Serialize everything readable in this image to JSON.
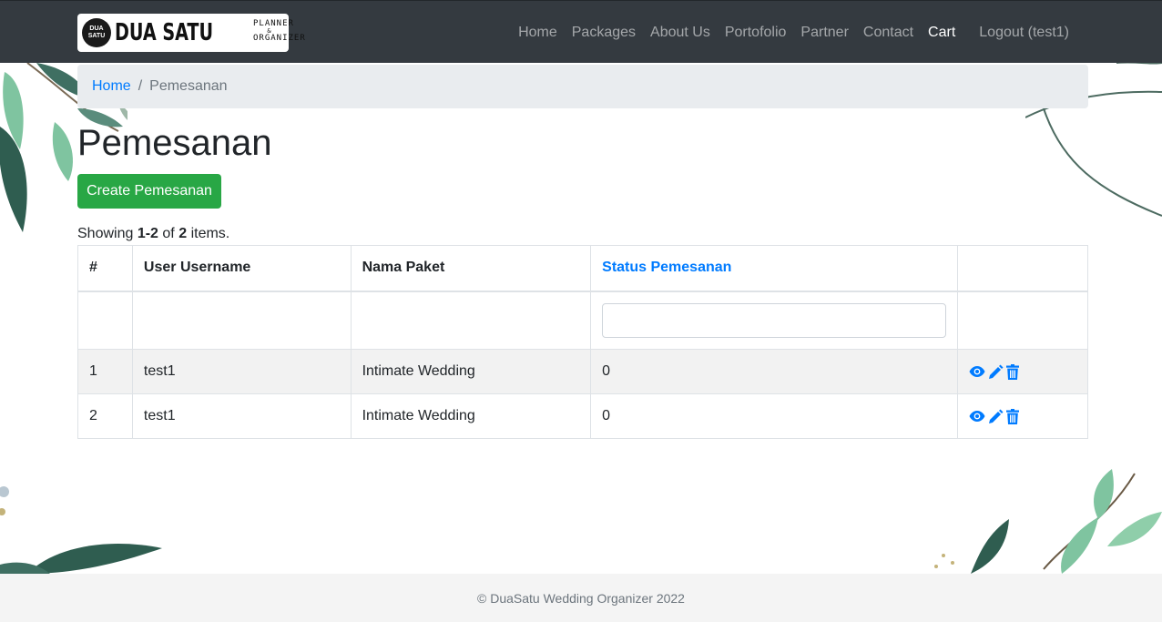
{
  "brand": {
    "badge_line1": "DUA",
    "badge_line2": "SATU",
    "name": "DUA SATU",
    "tagline1": "PLANNER",
    "tagline2": "&",
    "tagline3": "ORGANIZER"
  },
  "nav": {
    "items": [
      {
        "label": "Home"
      },
      {
        "label": "Packages"
      },
      {
        "label": "About Us"
      },
      {
        "label": "Portofolio"
      },
      {
        "label": "Partner"
      },
      {
        "label": "Contact"
      },
      {
        "label": "Cart"
      }
    ],
    "logout_label": "Logout (test1)"
  },
  "breadcrumb": {
    "home": "Home",
    "separator": "/",
    "current": "Pemesanan"
  },
  "page": {
    "title": "Pemesanan",
    "create_button": "Create Pemesanan",
    "summary_prefix": "Showing",
    "summary_range": "1-2",
    "summary_of": "of",
    "summary_total": "2",
    "summary_suffix": "items."
  },
  "table": {
    "columns": [
      "#",
      "User Username",
      "Nama Paket",
      "Status Pemesanan",
      ""
    ],
    "filter_value": "",
    "rows": [
      {
        "no": "1",
        "user": "test1",
        "paket": "Intimate Wedding",
        "status": "0"
      },
      {
        "no": "2",
        "user": "test1",
        "paket": "Intimate Wedding",
        "status": "0"
      }
    ],
    "action_icons": [
      "eye-icon",
      "pencil-icon",
      "trash-icon"
    ]
  },
  "footer": {
    "text": "© DuaSatu Wedding Organizer 2022"
  },
  "colors": {
    "navbar": "#343a40",
    "link": "#007bff",
    "success": "#28a745",
    "leaf_dark": "#2f5d50",
    "leaf_light": "#7fc4a0"
  }
}
